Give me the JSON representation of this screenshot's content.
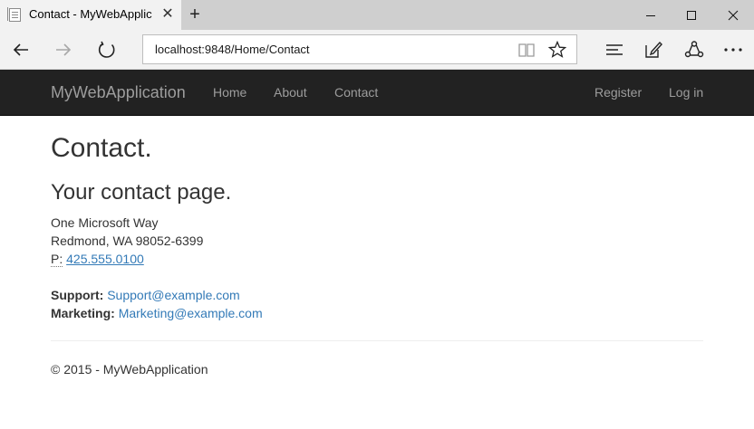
{
  "browser": {
    "tab_title": "Contact - MyWebApplic",
    "close_tab_symbol": "✕",
    "new_tab_symbol": "+",
    "address": "localhost:9848/Home/Contact",
    "icons": [
      "back-icon",
      "forward-icon",
      "refresh-icon",
      "reading-view-icon",
      "favorite-star-icon",
      "hub-icon",
      "web-note-icon",
      "share-icon",
      "more-icon",
      "minimize-icon",
      "maximize-icon",
      "close-window-icon"
    ]
  },
  "navbar": {
    "brand": "MyWebApplication",
    "links": [
      "Home",
      "About",
      "Contact"
    ],
    "register": "Register",
    "login": "Log in",
    "background": "#222222",
    "link_color": "#9d9d9d"
  },
  "page": {
    "title": "Contact.",
    "subtitle": "Your contact page.",
    "address_line1": "One Microsoft Way",
    "address_line2": "Redmond, WA 98052-6399",
    "phone_label": "P:",
    "phone": "425.555.0100",
    "support_label": "Support:",
    "support_email": "Support@example.com",
    "marketing_label": "Marketing:",
    "marketing_email": "Marketing@example.com",
    "link_color": "#337ab7"
  },
  "footer": {
    "text": "© 2015 - MyWebApplication"
  }
}
